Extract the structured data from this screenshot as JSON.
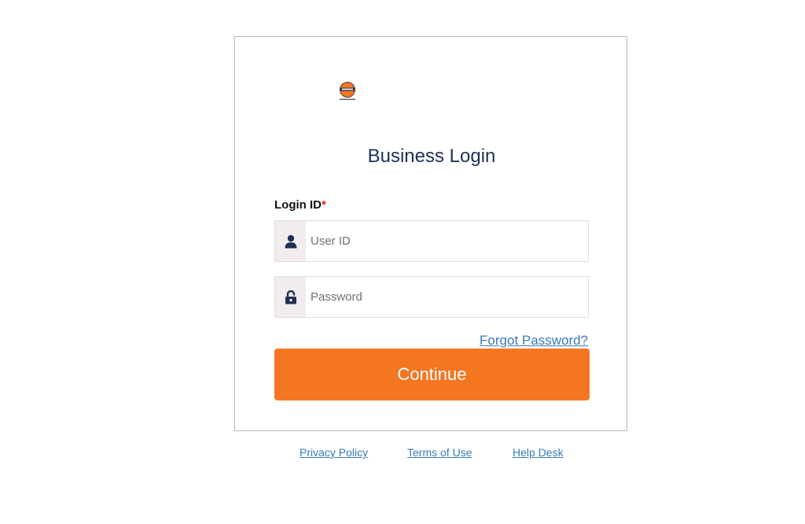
{
  "login": {
    "title": "Business Login",
    "login_id_label": "Login ID",
    "required_mark": "*",
    "user_id_placeholder": "User ID",
    "password_placeholder": "Password",
    "forgot_password": "Forgot Password?",
    "continue_label": "Continue"
  },
  "footer": {
    "privacy": "Privacy Policy",
    "terms": "Terms of Use",
    "help": "Help Desk"
  },
  "icons": {
    "user": "user-icon",
    "lock": "unlock-icon"
  },
  "colors": {
    "accent": "#f47621",
    "link": "#3a7ab8",
    "title": "#1f2f56",
    "icon": "#1f2f56",
    "addon_bg": "#f2ecec"
  }
}
